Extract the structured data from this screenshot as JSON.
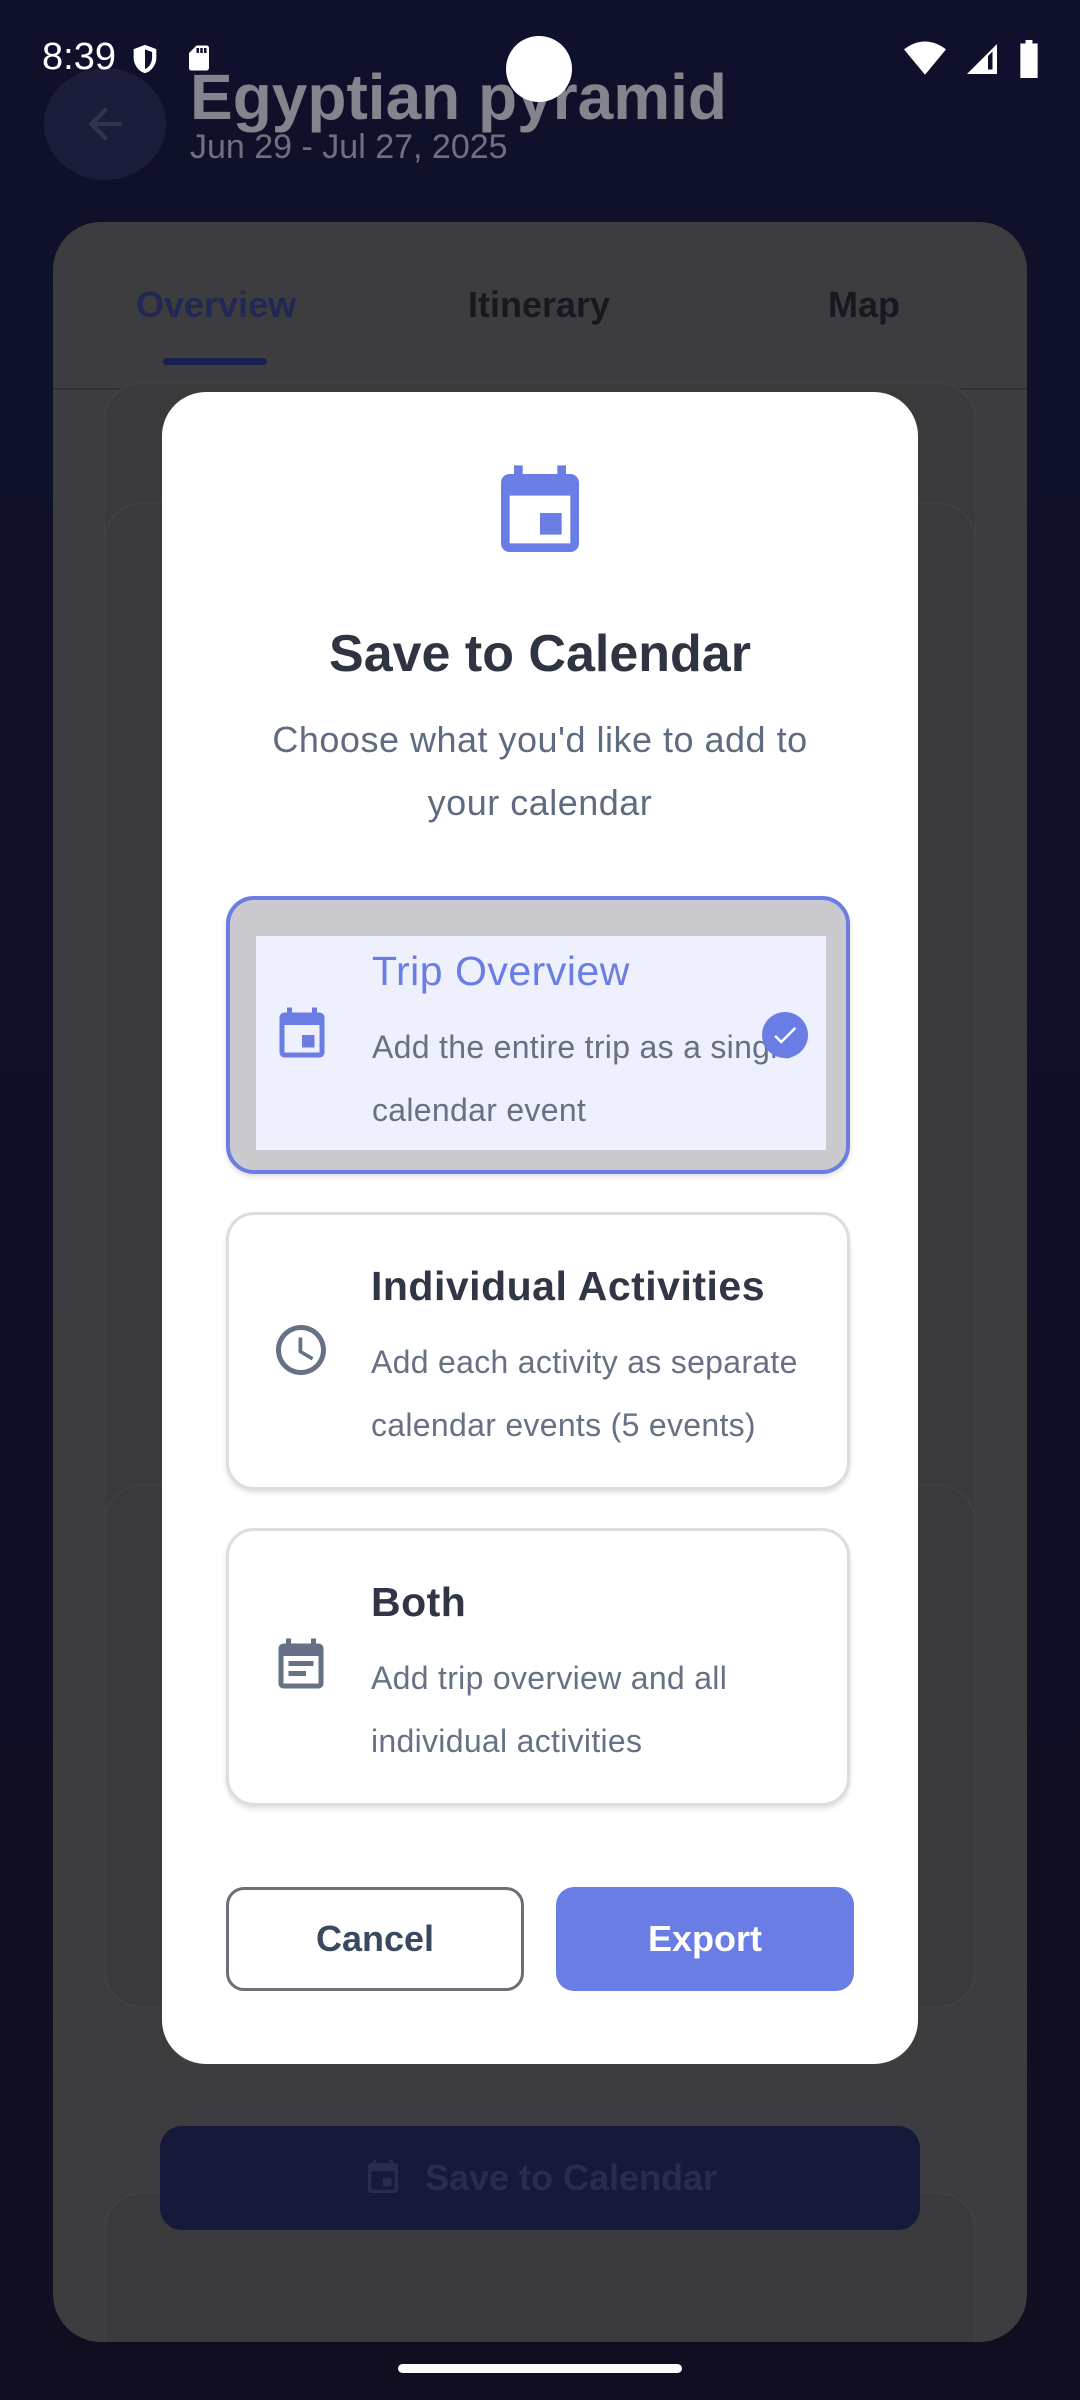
{
  "status": {
    "time": "8:39"
  },
  "header": {
    "title": "Egyptian pyramid",
    "dates": "Jun 29 - Jul 27, 2025"
  },
  "tabs": [
    {
      "label": "Overview",
      "active": true
    },
    {
      "label": "Itinerary",
      "active": false
    },
    {
      "label": "Map",
      "active": false
    }
  ],
  "background_button": {
    "label": "Save to Calendar"
  },
  "dialog": {
    "title": "Save to Calendar",
    "subtitle": "Choose what you'd like to add to your calendar",
    "options": [
      {
        "title": "Trip Overview",
        "description": "Add the entire trip as a single calendar event",
        "icon": "calendar-icon",
        "selected": true
      },
      {
        "title": "Individual Activities",
        "description": "Add each activity as separate calendar events (5 events)",
        "icon": "clock-icon",
        "selected": false
      },
      {
        "title": "Both",
        "description": "Add trip overview and all individual activities",
        "icon": "calendar-event-icon",
        "selected": false
      }
    ],
    "cancel_label": "Cancel",
    "export_label": "Export"
  },
  "colors": {
    "accent": "#6a7de4",
    "text_dark": "#303645",
    "text_muted": "#667185"
  }
}
